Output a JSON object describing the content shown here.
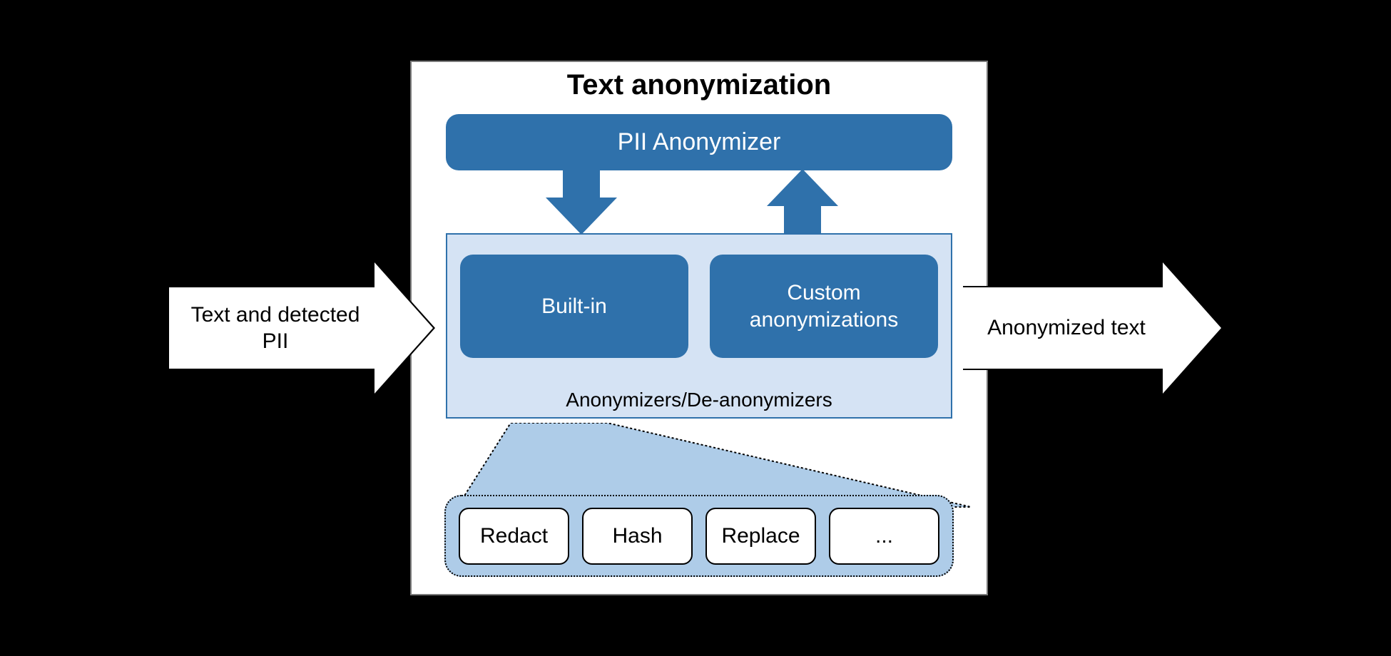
{
  "input_label": "Text and detected PII",
  "output_label": "Anonymized text",
  "main": {
    "title": "Text anonymization",
    "pii_box": "PII Anonymizer",
    "anonymizers": {
      "builtin_label": "Built-in",
      "custom_label": "Custom anonymizations",
      "container_label": "Anonymizers/De-anonymizers"
    },
    "options": [
      "Redact",
      "Hash",
      "Replace",
      "..."
    ]
  },
  "colors": {
    "box_blue": "#2f71ab",
    "light_blue_bg": "#d5e3f4",
    "options_bg": "#aecce8"
  }
}
